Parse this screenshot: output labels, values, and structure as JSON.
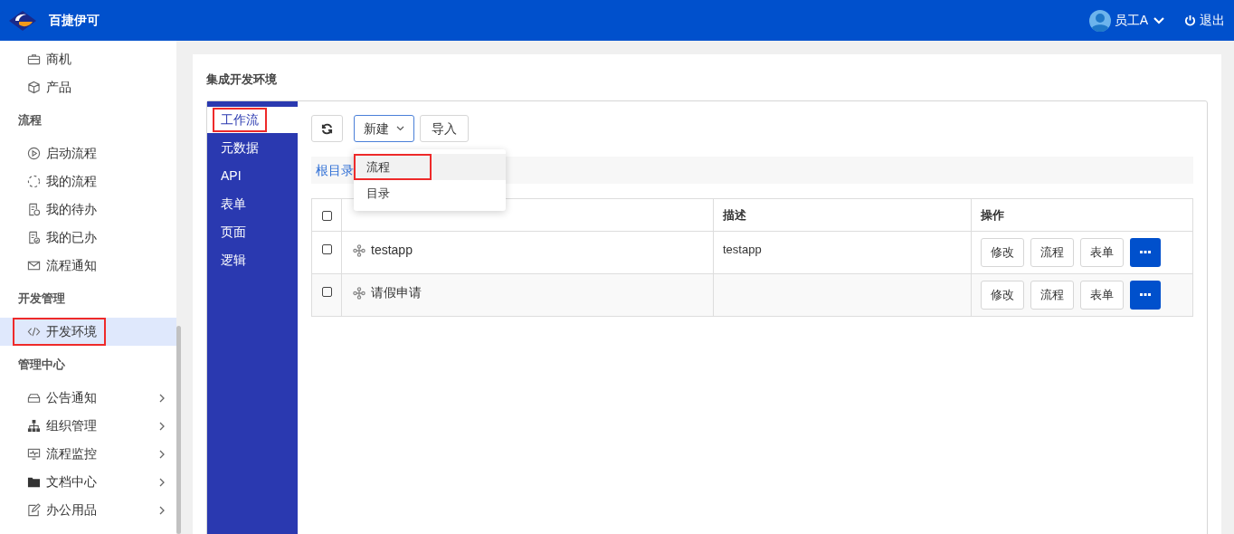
{
  "header": {
    "brand": "百捷伊可",
    "user": "员工A",
    "logout": "退出"
  },
  "sidebar": [
    {
      "kind": "item",
      "label": "商机",
      "selected": false,
      "highlighted": false,
      "has_children": false
    },
    {
      "kind": "item",
      "label": "产品",
      "selected": false,
      "highlighted": false,
      "has_children": false
    },
    {
      "kind": "heading",
      "label": "流程"
    },
    {
      "kind": "item",
      "label": "启动流程",
      "selected": false,
      "highlighted": false,
      "has_children": false
    },
    {
      "kind": "item",
      "label": "我的流程",
      "selected": false,
      "highlighted": false,
      "has_children": false
    },
    {
      "kind": "item",
      "label": "我的待办",
      "selected": false,
      "highlighted": false,
      "has_children": false
    },
    {
      "kind": "item",
      "label": "我的已办",
      "selected": false,
      "highlighted": false,
      "has_children": false
    },
    {
      "kind": "item",
      "label": "流程通知",
      "selected": false,
      "highlighted": false,
      "has_children": false
    },
    {
      "kind": "heading",
      "label": "开发管理"
    },
    {
      "kind": "item",
      "label": "开发环境",
      "selected": true,
      "highlighted": true,
      "has_children": false
    },
    {
      "kind": "heading",
      "label": "管理中心"
    },
    {
      "kind": "item",
      "label": "公告通知",
      "selected": false,
      "highlighted": false,
      "has_children": true
    },
    {
      "kind": "item",
      "label": "组织管理",
      "selected": false,
      "highlighted": false,
      "has_children": true
    },
    {
      "kind": "item",
      "label": "流程监控",
      "selected": false,
      "highlighted": false,
      "has_children": true
    },
    {
      "kind": "item",
      "label": "文档中心",
      "selected": false,
      "highlighted": false,
      "has_children": true
    },
    {
      "kind": "item",
      "label": "办公用品",
      "selected": false,
      "highlighted": false,
      "has_children": true
    }
  ],
  "page_title": "集成开发环境",
  "tabs": [
    {
      "label": "工作流",
      "selected": true,
      "highlighted": true
    },
    {
      "label": "元数据",
      "selected": false,
      "highlighted": false
    },
    {
      "label": "API",
      "selected": false,
      "highlighted": false
    },
    {
      "label": "表单",
      "selected": false,
      "highlighted": false
    },
    {
      "label": "页面",
      "selected": false,
      "highlighted": false
    },
    {
      "label": "逻辑",
      "selected": false,
      "highlighted": false
    }
  ],
  "toolbar": {
    "new_button": "新建",
    "import_button": "导入"
  },
  "new_menu": [
    {
      "label": "流程",
      "selected": true,
      "highlighted": true
    },
    {
      "label": "目录",
      "selected": false,
      "highlighted": false
    }
  ],
  "breadcrumb": "根目录",
  "table": {
    "columns": [
      "描述",
      "操作"
    ],
    "all_checked": false,
    "rows": [
      {
        "checked": false,
        "name": "testapp",
        "description": "testapp",
        "actions": [
          "修改",
          "流程",
          "表单"
        ]
      },
      {
        "checked": false,
        "name": "请假申请",
        "description": "",
        "actions": [
          "修改",
          "流程",
          "表单"
        ]
      }
    ]
  }
}
